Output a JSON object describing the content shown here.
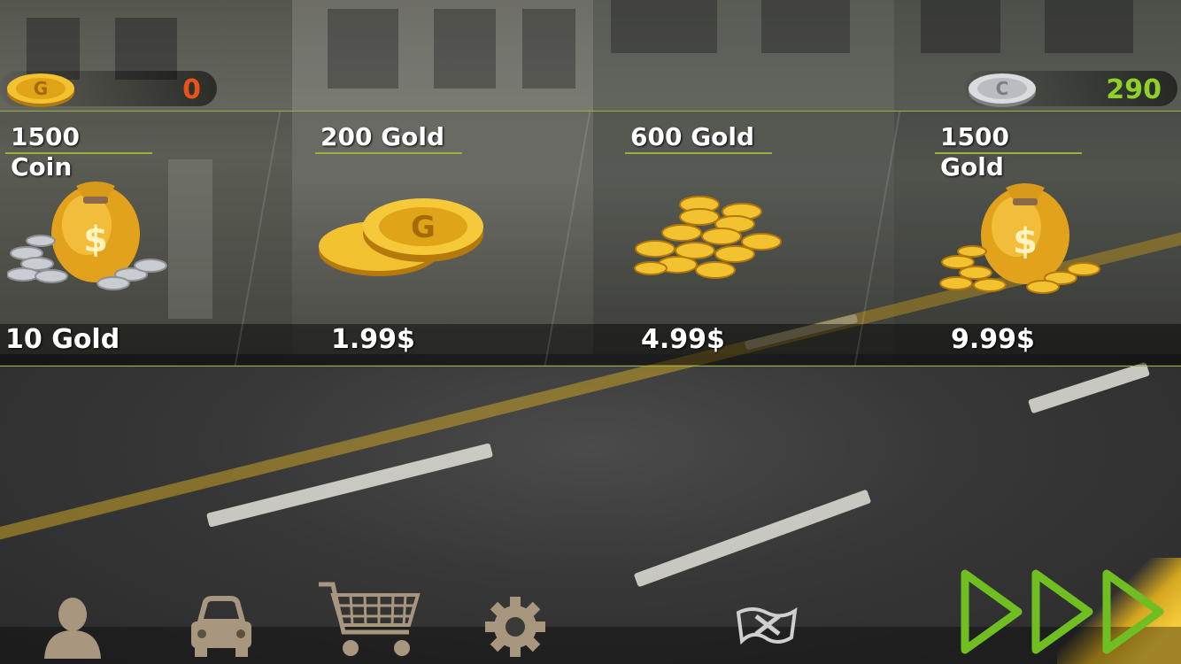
{
  "hud": {
    "gold_balance": "0",
    "coin_balance": "290"
  },
  "shop": {
    "items": [
      {
        "title": "1500 Coin",
        "price": "10 Gold",
        "icon": "money-bag-silver-icon"
      },
      {
        "title": "200 Gold",
        "price": "1.99$",
        "icon": "gold-coins-pair-icon"
      },
      {
        "title": "600 Gold",
        "price": "4.99$",
        "icon": "gold-coin-pile-icon"
      },
      {
        "title": "1500 Gold",
        "price": "9.99$",
        "icon": "money-bag-gold-icon"
      }
    ]
  },
  "nav": {
    "items": [
      {
        "name": "profile",
        "icon": "person-icon"
      },
      {
        "name": "garage",
        "icon": "car-icon"
      },
      {
        "name": "shop",
        "icon": "shopping-cart-icon"
      },
      {
        "name": "settings",
        "icon": "gear-icon"
      },
      {
        "name": "leaderboard",
        "icon": "flag-icon"
      },
      {
        "name": "play",
        "icon": "triple-play-icon"
      }
    ]
  },
  "colors": {
    "accent_green": "#8fd12a",
    "gold_balance_color": "#e8531c",
    "divider": "#9ab23a"
  }
}
